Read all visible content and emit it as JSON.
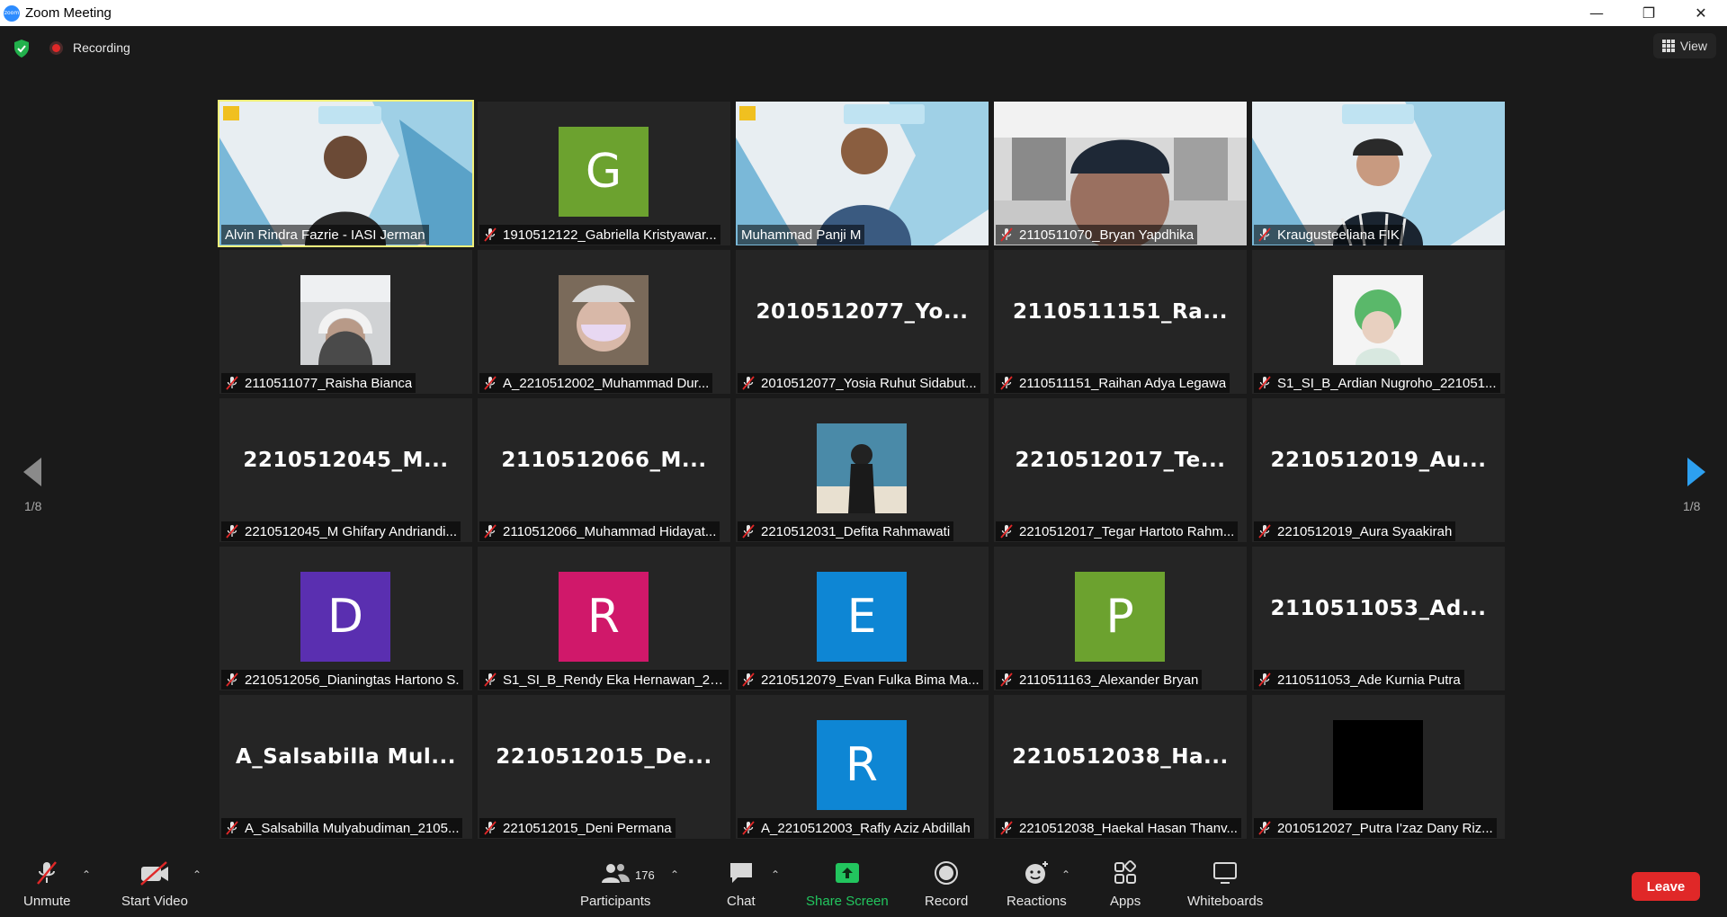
{
  "window": {
    "title": "Zoom Meeting",
    "logo_text": "zoom"
  },
  "infobar": {
    "recording_label": "Recording",
    "view_label": "View"
  },
  "pagination": {
    "left": "1/8",
    "right": "1/8"
  },
  "tiles": [
    {
      "name": "Alvin Rindra Fazrie - IASI Jerman",
      "type": "video",
      "muted": false,
      "active": true
    },
    {
      "name": "1910512122_Gabriella Kristyawar...",
      "type": "avatar",
      "letter": "G",
      "color": "#6ca22f",
      "muted": true
    },
    {
      "name": "Muhammad Panji M",
      "type": "video",
      "muted": false
    },
    {
      "name": "2110511070_Bryan Yapdhika",
      "type": "video",
      "muted": true
    },
    {
      "name": "Kraugusteeliana FIK",
      "type": "video",
      "muted": true
    },
    {
      "name": "2110511077_Raisha Bianca",
      "type": "photo",
      "muted": true
    },
    {
      "name": "A_2210512002_Muhammad Dur...",
      "type": "photo",
      "muted": true
    },
    {
      "name": "2010512077_Yosia Ruhut Sidabut...",
      "type": "text",
      "big": "2010512077_Yo...",
      "muted": true
    },
    {
      "name": "2110511151_Raihan Adya Legawa",
      "type": "text",
      "big": "2110511151_Ra...",
      "muted": true
    },
    {
      "name": "S1_SI_B_Ardian Nugroho_221051...",
      "type": "photo",
      "muted": true
    },
    {
      "name": "2210512045_M Ghifary Andriandi...",
      "type": "text",
      "big": "2210512045_M...",
      "muted": true
    },
    {
      "name": "2110512066_Muhammad Hidayat...",
      "type": "text",
      "big": "2110512066_M...",
      "muted": true
    },
    {
      "name": "2210512031_Defita Rahmawati",
      "type": "photo",
      "muted": true
    },
    {
      "name": "2210512017_Tegar Hartoto Rahm...",
      "type": "text",
      "big": "2210512017_Te...",
      "muted": true
    },
    {
      "name": "2210512019_Aura Syaakirah",
      "type": "text",
      "big": "2210512019_Au...",
      "muted": true
    },
    {
      "name": "2210512056_Dianingtas Hartono S.",
      "type": "avatar",
      "letter": "D",
      "color": "#5a2fb0",
      "muted": true
    },
    {
      "name": "S1_SI_B_Rendy Eka Hernawan_22...",
      "type": "avatar",
      "letter": "R",
      "color": "#d0186a",
      "muted": true
    },
    {
      "name": "2210512079_Evan Fulka Bima Ma...",
      "type": "avatar",
      "letter": "E",
      "color": "#0e86d4",
      "muted": true
    },
    {
      "name": "2110511163_Alexander Bryan",
      "type": "avatar",
      "letter": "P",
      "color": "#6ca22f",
      "muted": true
    },
    {
      "name": "2110511053_Ade Kurnia Putra",
      "type": "text",
      "big": "2110511053_Ad...",
      "muted": true
    },
    {
      "name": "A_Salsabilla Mulyabudiman_2105...",
      "type": "text",
      "big": "A_Salsabilla  Mul...",
      "muted": true
    },
    {
      "name": "2210512015_Deni Permana",
      "type": "text",
      "big": "2210512015_De...",
      "muted": true
    },
    {
      "name": "A_2210512003_Rafly Aziz Abdillah",
      "type": "avatar",
      "letter": "R",
      "color": "#0e86d4",
      "muted": true
    },
    {
      "name": "2210512038_Haekal Hasan Thanv...",
      "type": "text",
      "big": "2210512038_Ha...",
      "muted": true
    },
    {
      "name": "2010512027_Putra I'zaz Dany Riz...",
      "type": "avatar",
      "letter": "",
      "color": "#000000",
      "muted": true
    }
  ],
  "toolbar": {
    "unmute": "Unmute",
    "start_video": "Start Video",
    "participants": "Participants",
    "participants_count": "176",
    "chat": "Chat",
    "share_screen": "Share Screen",
    "record": "Record",
    "reactions": "Reactions",
    "apps": "Apps",
    "whiteboards": "Whiteboards",
    "leave": "Leave"
  },
  "colors": {
    "share_green": "#22c55e",
    "leave_red": "#e02828",
    "active_border": "#f0f07a",
    "arrow_blue": "#2da0f0"
  }
}
